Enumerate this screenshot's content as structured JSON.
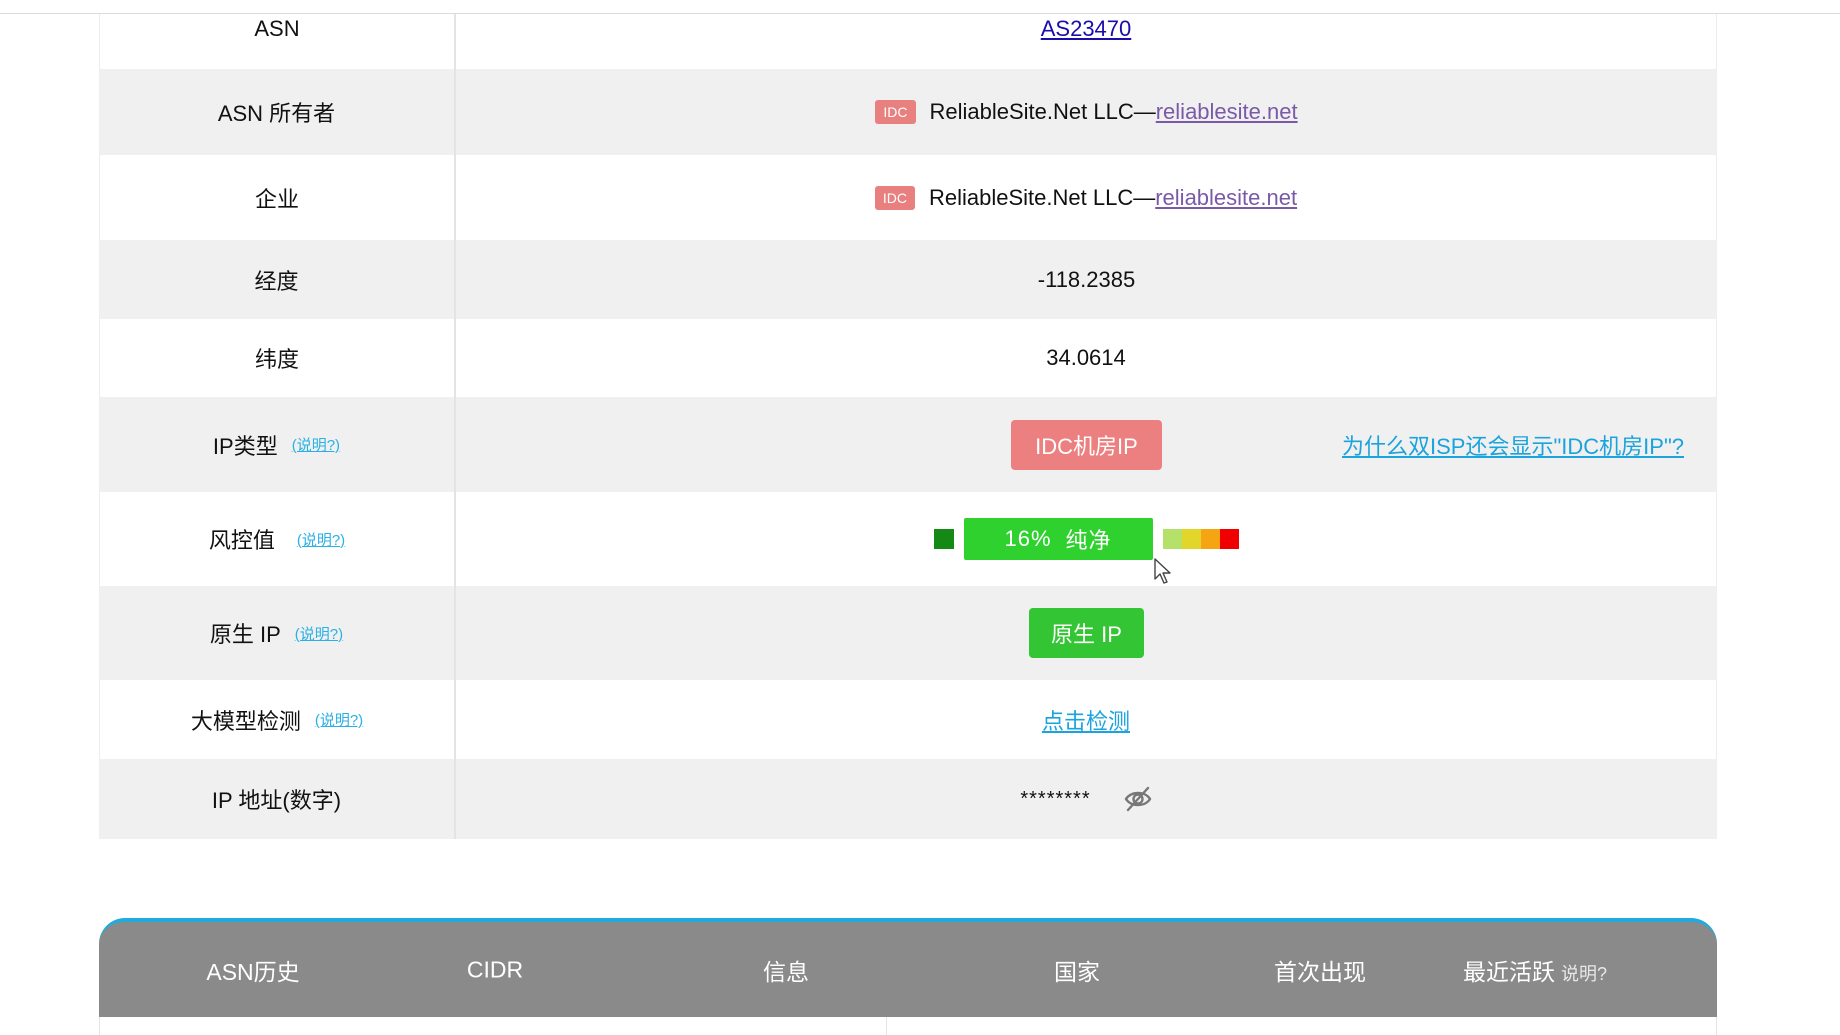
{
  "rows": {
    "asn": {
      "label": "ASN",
      "value": "AS23470"
    },
    "asn_owner": {
      "label": "ASN 所有者",
      "badge": "IDC",
      "name": "ReliableSite.Net LLC—",
      "link": "reliablesite.net"
    },
    "enterprise": {
      "label": "企业",
      "badge": "IDC",
      "name": "ReliableSite.Net LLC—",
      "link": "reliablesite.net"
    },
    "longitude": {
      "label": "经度",
      "value": "-118.2385"
    },
    "latitude": {
      "label": "纬度",
      "value": "34.0614"
    },
    "ip_type": {
      "label": "IP类型",
      "help": "(说明?)",
      "value": "IDC机房IP",
      "side_link": "为什么双ISP还会显示\"IDC机房IP\"?"
    },
    "risk": {
      "label": "风控值",
      "help": "(说明?)",
      "percent": "16%",
      "status": "纯净",
      "scale_colors": [
        "#b5e06a",
        "#e2d62a",
        "#f5a412",
        "#f00000"
      ],
      "marker_color": "#148a14"
    },
    "native_ip": {
      "label": "原生 IP",
      "help": "(说明?)",
      "value": "原生 IP"
    },
    "llm_detect": {
      "label": "大模型检测",
      "help": "(说明?)",
      "value": "点击检测"
    },
    "ip_numeric": {
      "label": "IP 地址(数字)",
      "value": "********"
    }
  },
  "asn_history_header": {
    "col1": "ASN历史",
    "col2": "CIDR",
    "col3": "信息",
    "col4": "国家",
    "col5": "首次出现",
    "col6": "最近活跃",
    "col6_help": "说明?"
  },
  "colors": {
    "accent_blue": "#22aadd",
    "idc_red": "#ec7f7f",
    "clean_green": "#2fd12f",
    "header_gray": "#8a8a8a"
  }
}
